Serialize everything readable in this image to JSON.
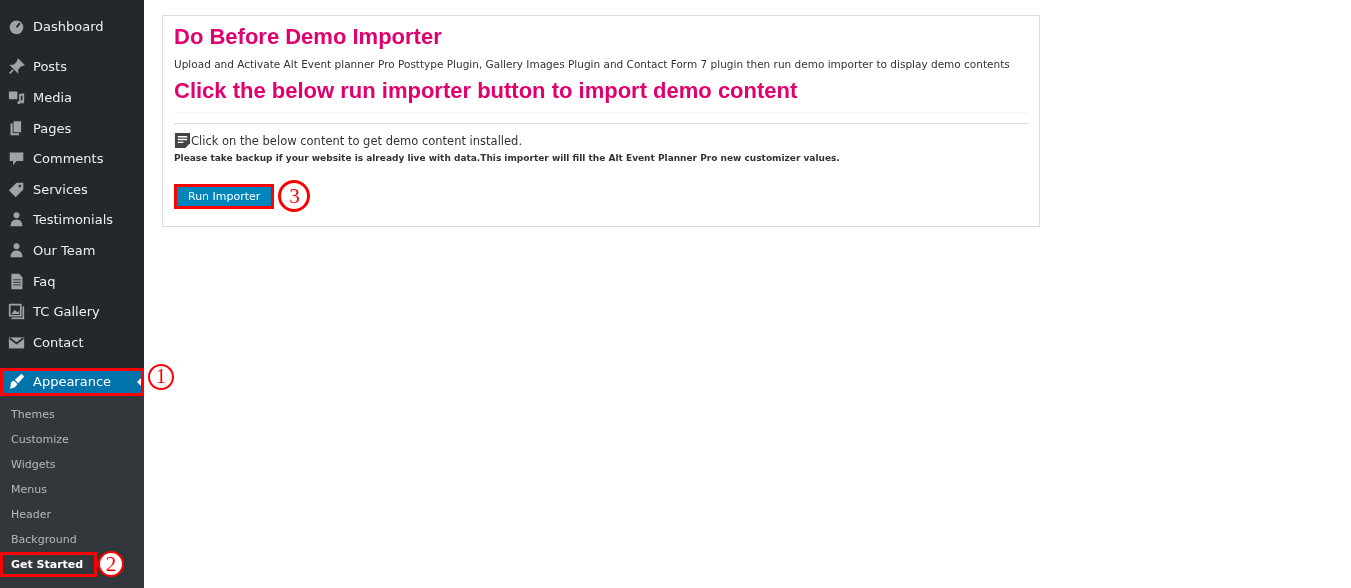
{
  "sidebar": {
    "items": [
      {
        "label": "Dashboard",
        "kind": "gauge",
        "selected": false
      },
      {
        "label": "Posts",
        "kind": "pin",
        "selected": false
      },
      {
        "label": "Media",
        "kind": "media",
        "selected": false
      },
      {
        "label": "Pages",
        "kind": "pages",
        "selected": false
      },
      {
        "label": "Comments",
        "kind": "comment",
        "selected": false
      },
      {
        "label": "Services",
        "kind": "tag",
        "selected": false
      },
      {
        "label": "Testimonials",
        "kind": "person",
        "selected": false
      },
      {
        "label": "Our Team",
        "kind": "person",
        "selected": false
      },
      {
        "label": "Faq",
        "kind": "doc",
        "selected": false
      },
      {
        "label": "TC Gallery",
        "kind": "gallery",
        "selected": false
      },
      {
        "label": "Contact",
        "kind": "mail",
        "selected": false
      },
      {
        "label": "Appearance",
        "kind": "brush",
        "selected": true,
        "highlighted": true,
        "callout": "1"
      }
    ],
    "submenu": [
      {
        "label": "Themes",
        "selected": false
      },
      {
        "label": "Customize",
        "selected": false
      },
      {
        "label": "Widgets",
        "selected": false
      },
      {
        "label": "Menus",
        "selected": false
      },
      {
        "label": "Header",
        "selected": false
      },
      {
        "label": "Background",
        "selected": false
      },
      {
        "label": "Get Started",
        "selected": true,
        "highlighted": true,
        "callout": "2"
      }
    ]
  },
  "panel": {
    "title": "Do Before Demo Importer",
    "description": "Upload and Activate Alt Event planner Pro Posttype Plugin, Gallery Images Plugin and Contact Form 7 plugin then run demo importer to display demo contents",
    "subtitle": "Click the below run importer button to import demo content",
    "info": "Click on the below content to get demo content installed.",
    "warning": "Please take backup if your website is already live with data.This importer will fill the Alt Event Planner Pro new customizer values.",
    "button": {
      "label": "Run Importer",
      "highlighted": true,
      "callout": "3"
    }
  }
}
